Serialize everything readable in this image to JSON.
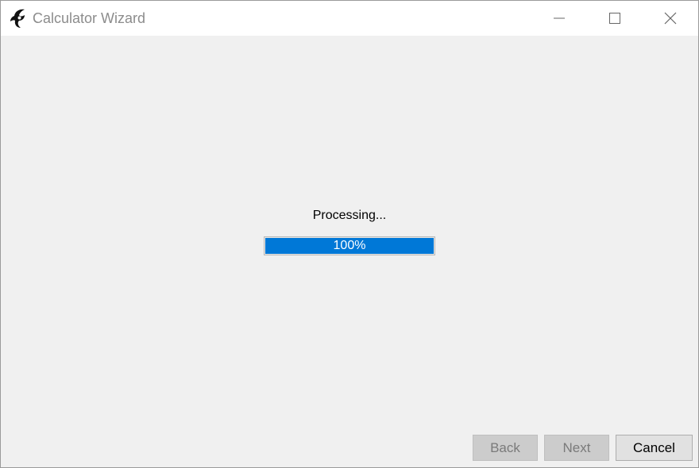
{
  "window": {
    "title": "Calculator Wizard",
    "icon": "app-logo-icon",
    "controls": [
      "minimize-icon",
      "maximize-icon",
      "close-icon"
    ]
  },
  "main": {
    "status_text": "Processing...",
    "progress": {
      "value_percent": 100,
      "label": "100%",
      "fill_color": "#0078d7"
    }
  },
  "buttons": {
    "back": {
      "label": "Back",
      "enabled": false
    },
    "next": {
      "label": "Next",
      "enabled": false
    },
    "cancel": {
      "label": "Cancel",
      "enabled": true
    }
  }
}
